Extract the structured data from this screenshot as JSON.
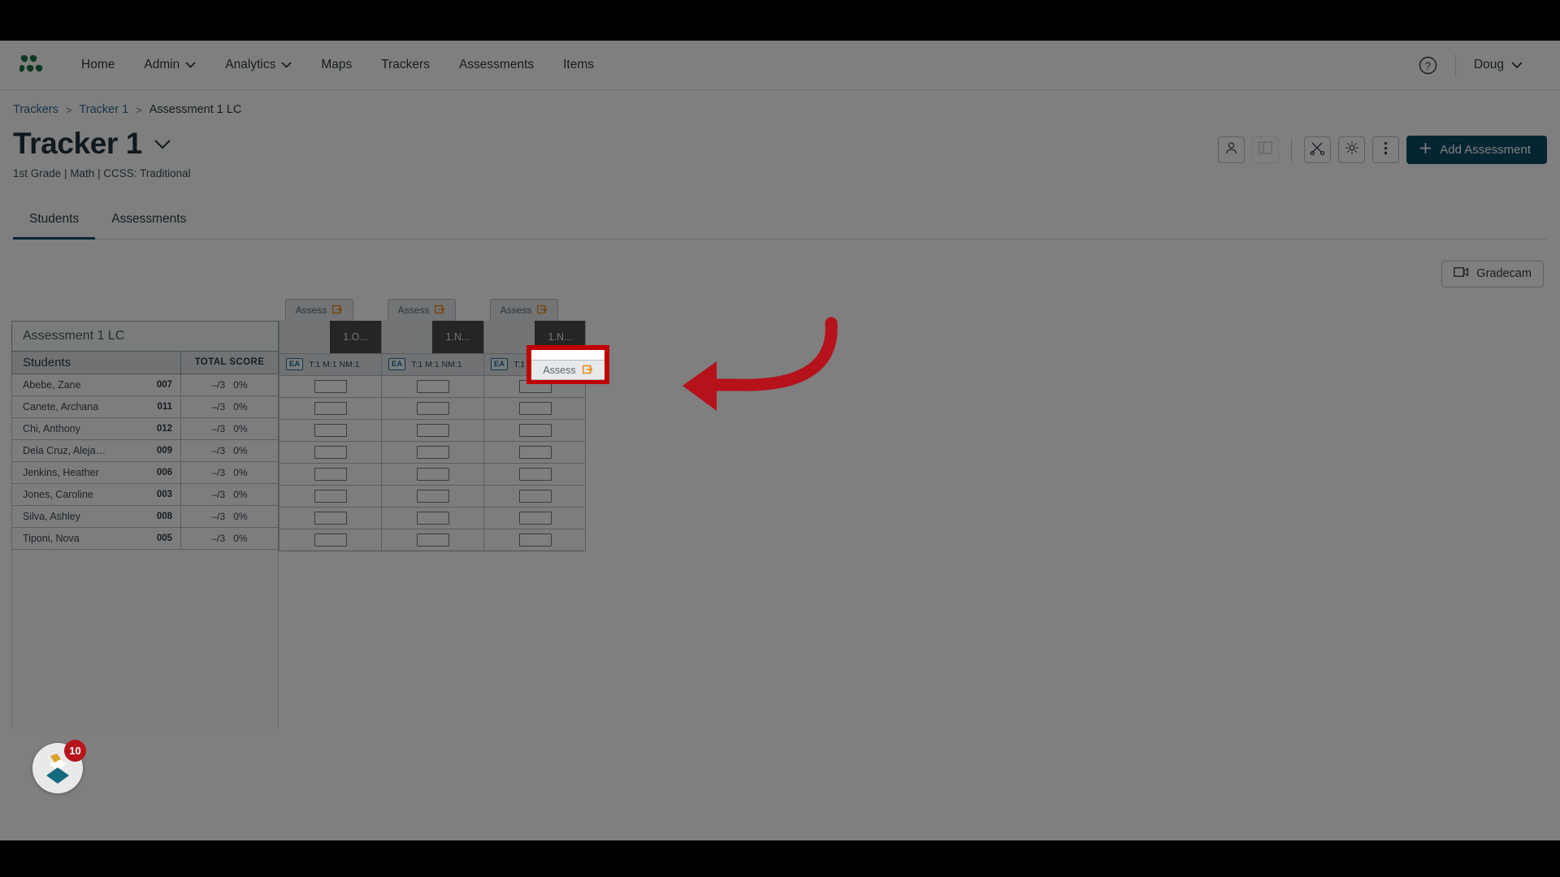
{
  "topnav": {
    "logo_icon": "data-logo-icon",
    "items": [
      {
        "label": "Home",
        "has_caret": false
      },
      {
        "label": "Admin",
        "has_caret": true
      },
      {
        "label": "Analytics",
        "has_caret": true
      },
      {
        "label": "Maps",
        "has_caret": false
      },
      {
        "label": "Trackers",
        "has_caret": false
      },
      {
        "label": "Assessments",
        "has_caret": false
      },
      {
        "label": "Items",
        "has_caret": false
      }
    ],
    "help_icon": "question-circle-icon",
    "user_label": "Doug",
    "user_caret_icon": "chevron-down-icon"
  },
  "breadcrumb": {
    "items": [
      "Trackers",
      "Tracker 1",
      "Assessment 1 LC"
    ],
    "separator": ">"
  },
  "header": {
    "title": "Tracker 1",
    "title_caret_icon": "chevron-down-icon",
    "subtitle": "1st Grade | Math | CCSS: Traditional",
    "actions": [
      {
        "name": "roster-button",
        "icon": "person-icon",
        "disabled": false
      },
      {
        "name": "panel-toggle-button",
        "icon": "sidebar-panel-icon",
        "disabled": true
      },
      {
        "name": "tools-button",
        "icon": "scissors-pencil-icon",
        "disabled": false
      },
      {
        "name": "settings-button",
        "icon": "gear-icon",
        "disabled": false
      },
      {
        "name": "more-options-button",
        "icon": "kebab-menu-icon",
        "disabled": false
      }
    ],
    "add_assessment_label": "Add Assessment",
    "add_assessment_icon": "plus-icon",
    "accent_color": "#0b4a67"
  },
  "tabs": [
    {
      "label": "Students",
      "active": true
    },
    {
      "label": "Assessments",
      "active": false
    }
  ],
  "gradecam": {
    "label": "Gradecam",
    "icon": "video-camera-icon"
  },
  "grid": {
    "assessment_name": "Assessment 1 LC",
    "students_header": "Students",
    "total_score_header": "TOTAL SCORE",
    "students": [
      {
        "name": "Abebe, Zane",
        "id": "007",
        "score": "–/3",
        "percent": "0%"
      },
      {
        "name": "Canete, Archana",
        "id": "011",
        "score": "–/3",
        "percent": "0%"
      },
      {
        "name": "Chi, Anthony",
        "id": "012",
        "score": "–/3",
        "percent": "0%"
      },
      {
        "name": "Dela Cruz, Aleja…",
        "id": "009",
        "score": "–/3",
        "percent": "0%"
      },
      {
        "name": "Jenkins, Heather",
        "id": "006",
        "score": "–/3",
        "percent": "0%"
      },
      {
        "name": "Jones, Caroline",
        "id": "003",
        "score": "–/3",
        "percent": "0%"
      },
      {
        "name": "Silva, Ashley",
        "id": "008",
        "score": "–/3",
        "percent": "0%"
      },
      {
        "name": "Tiponi, Nova",
        "id": "005",
        "score": "–/3",
        "percent": "0%"
      }
    ],
    "columns": [
      {
        "assess_label": "Assess",
        "assess_icon": "external-link-icon",
        "standard": "1.O...",
        "ea_chip": "EA",
        "meta": "T:1  M:1  NM:1",
        "highlighted": false
      },
      {
        "assess_label": "Assess",
        "assess_icon": "external-link-icon",
        "standard": "1.N...",
        "ea_chip": "EA",
        "meta": "T:1  M:1  NM:1",
        "highlighted": false
      },
      {
        "assess_label": "Assess",
        "assess_icon": "external-link-icon",
        "standard": "1.N...",
        "ea_chip": "EA",
        "meta": "T:1  M:1  NM:1",
        "highlighted": true
      }
    ],
    "cell_value": ""
  },
  "highlight": {
    "assess_label": "Assess",
    "assess_icon": "external-link-icon",
    "border_color": "#c00000",
    "arrow_color": "#b5121b"
  },
  "floating_widget": {
    "badge_count": "10",
    "icon": "diamond-stack-icon",
    "badge_color": "#b8141c"
  }
}
